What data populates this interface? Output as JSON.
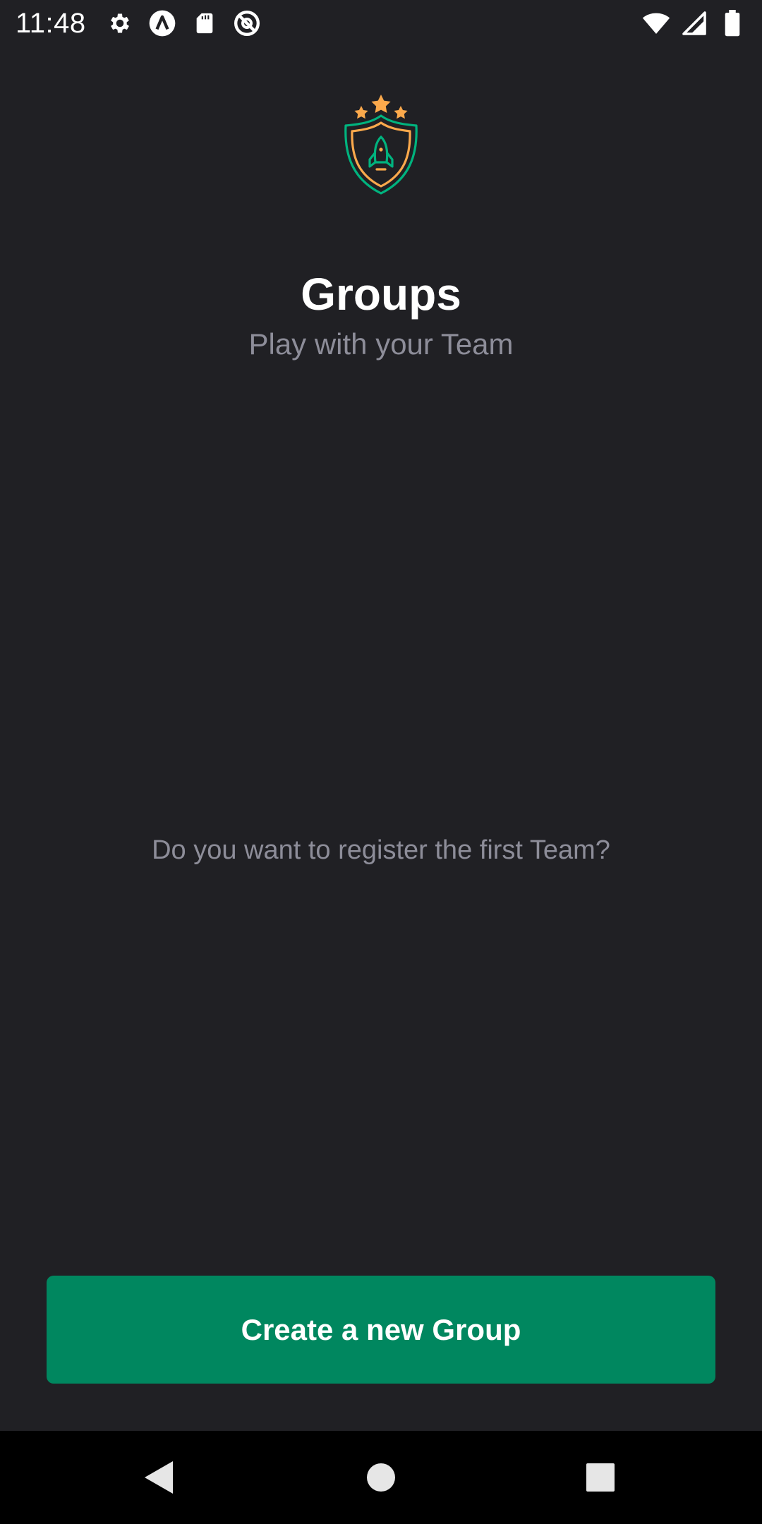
{
  "status_bar": {
    "time": "11:48",
    "left_icons": [
      "gear-icon",
      "a-circle-icon",
      "sd-card-icon",
      "at-circle-icon"
    ],
    "right_icons": [
      "wifi-icon",
      "signal-icon",
      "battery-icon"
    ]
  },
  "header": {
    "logo_icon": "shield-rocket-stars-icon",
    "title": "Groups",
    "subtitle": "Play with your Team"
  },
  "main": {
    "empty_message": "Do you want to register the first Team?"
  },
  "footer": {
    "create_button_label": "Create a new Group"
  },
  "nav_bar": {
    "buttons": [
      "back-icon",
      "home-icon",
      "recents-icon"
    ]
  },
  "colors": {
    "background": "#202024",
    "accent": "#00875f",
    "logo_orange": "#fba94c",
    "logo_green": "#00b37e",
    "muted_text": "#8d8d99"
  }
}
